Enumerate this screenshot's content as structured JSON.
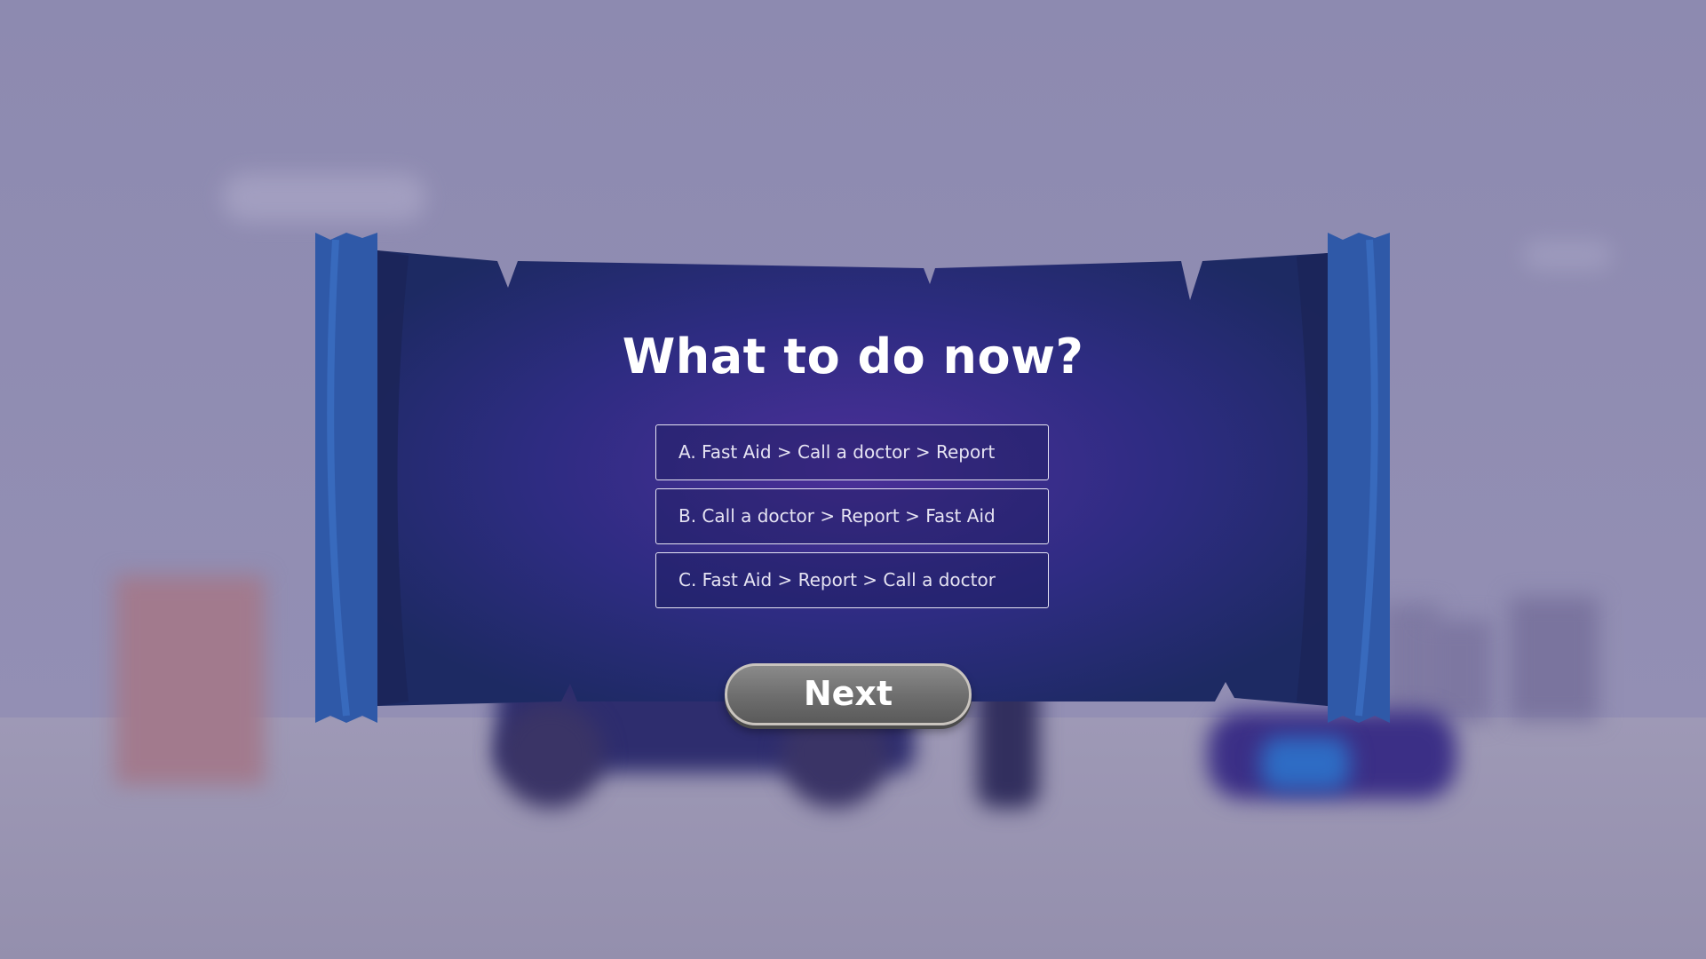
{
  "question": {
    "title": "What to do now?"
  },
  "options": [
    {
      "label": "A. Fast Aid > Call a doctor > Report"
    },
    {
      "label": "B. Call a doctor > Report > Fast Aid"
    },
    {
      "label": "C. Fast Aid > Report > Call a doctor"
    }
  ],
  "next_button": {
    "label": "Next"
  },
  "colors": {
    "banner_dark": "#1f2a63",
    "banner_glow": "#4a2f96",
    "curtain": "#2f59a8",
    "button": "#6e6e6e",
    "background": "#8e8baf"
  }
}
